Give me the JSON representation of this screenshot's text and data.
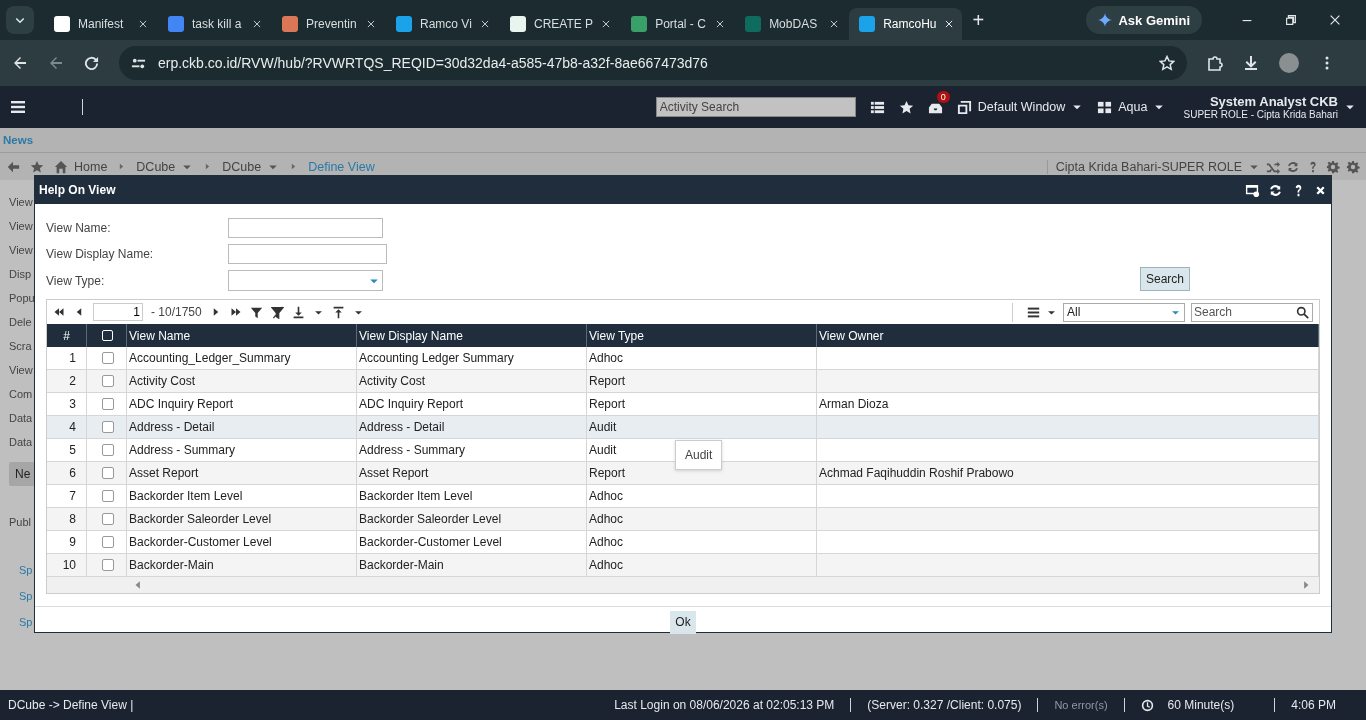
{
  "browser": {
    "tabs": [
      {
        "title": "Manifest",
        "selected": false
      },
      {
        "title": "task kill a",
        "selected": false
      },
      {
        "title": "Preventin",
        "selected": false
      },
      {
        "title": "Ramco Vi",
        "selected": false
      },
      {
        "title": "CREATE P",
        "selected": false
      },
      {
        "title": "Portal - C",
        "selected": false
      },
      {
        "title": "MobDAS",
        "selected": false
      },
      {
        "title": "RamcoHu",
        "selected": true
      }
    ],
    "new_tab": "+",
    "gemini": "Ask Gemini",
    "url": "erp.ckb.co.id/RVW/hub/?RVWRTQS_REQID=30d32da4-a585-47b8-a32f-8ae667473d76"
  },
  "header": {
    "activity_search_placeholder": "Activity Search",
    "notification_count": "0",
    "window": "Default Window",
    "theme": "Aqua",
    "user": "System Analyst CKB",
    "role": "SUPER ROLE - Cipta Krida Bahari"
  },
  "news": "News",
  "breadcrumb": {
    "items": [
      {
        "label": "Home",
        "dropdown": false
      },
      {
        "label": "DCube",
        "dropdown": true
      },
      {
        "label": "DCube",
        "dropdown": true
      }
    ],
    "current": "Define View",
    "role_selector": "Cipta Krida Bahari-SUPER ROLE"
  },
  "background": {
    "labels": [
      "View",
      "View",
      "View",
      "Disp",
      "Popu",
      "Dele",
      "Scra",
      "View",
      "Com",
      "Data",
      "Data"
    ],
    "button": "Ne",
    "label": "Publ",
    "links": [
      "Sp",
      "Sp",
      "Sp"
    ]
  },
  "dialog": {
    "title": "Help On View",
    "fields": [
      {
        "label": "View Name:",
        "kind": "text"
      },
      {
        "label": "View Display Name:",
        "kind": "text"
      },
      {
        "label": "View Type:",
        "kind": "select"
      }
    ],
    "search_button": "Search",
    "pager": {
      "page": "1",
      "range": "- 10/1750"
    },
    "filter": "All",
    "grid_search_placeholder": "Search",
    "columns": [
      "#",
      "",
      "View Name",
      "View Display Name",
      "View Type",
      "View Owner"
    ],
    "all_checked": false,
    "rows": [
      {
        "checked": false,
        "hovered": false,
        "cells": [
          "1",
          "",
          "Accounting_Ledger_Summary",
          "Accounting Ledger Summary",
          "Adhoc",
          ""
        ]
      },
      {
        "checked": false,
        "hovered": false,
        "cells": [
          "2",
          "",
          "Activity Cost",
          "Activity Cost",
          "Report",
          ""
        ]
      },
      {
        "checked": false,
        "hovered": false,
        "cells": [
          "3",
          "",
          "ADC Inquiry Report",
          "ADC Inquiry Report",
          "Report",
          "Arman Dioza"
        ]
      },
      {
        "checked": false,
        "hovered": true,
        "cells": [
          "4",
          "",
          "Address - Detail",
          "Address - Detail",
          "Audit",
          ""
        ]
      },
      {
        "checked": false,
        "hovered": false,
        "cells": [
          "5",
          "",
          "Address - Summary",
          "Address - Summary",
          "Audit",
          ""
        ]
      },
      {
        "checked": false,
        "hovered": false,
        "cells": [
          "6",
          "",
          "Asset Report",
          "Asset Report",
          "Report",
          "Achmad Faqihuddin Roshif Prabowo"
        ]
      },
      {
        "checked": false,
        "hovered": false,
        "cells": [
          "7",
          "",
          "Backorder Item Level",
          "Backorder Item Level",
          "Adhoc",
          ""
        ]
      },
      {
        "checked": false,
        "hovered": false,
        "cells": [
          "8",
          "",
          "Backorder Saleorder Level",
          "Backorder Saleorder Level",
          "Adhoc",
          ""
        ]
      },
      {
        "checked": false,
        "hovered": false,
        "cells": [
          "9",
          "",
          "Backorder-Customer Level",
          "Backorder-Customer Level",
          "Adhoc",
          ""
        ]
      },
      {
        "checked": false,
        "hovered": false,
        "cells": [
          "10",
          "",
          "Backorder-Main",
          "Backorder-Main",
          "Adhoc",
          ""
        ]
      }
    ],
    "tooltip": "Audit",
    "ok_button": "Ok"
  },
  "status_bar": {
    "path": "DCube -> Define View |",
    "last_login": "Last Login on 08/06/2026 at 02:05:13 PM",
    "timing": "(Server: 0.327 /Client: 0.075)",
    "errors": "No error(s)",
    "session": "60 Minute(s)",
    "time": "4:06 PM"
  }
}
